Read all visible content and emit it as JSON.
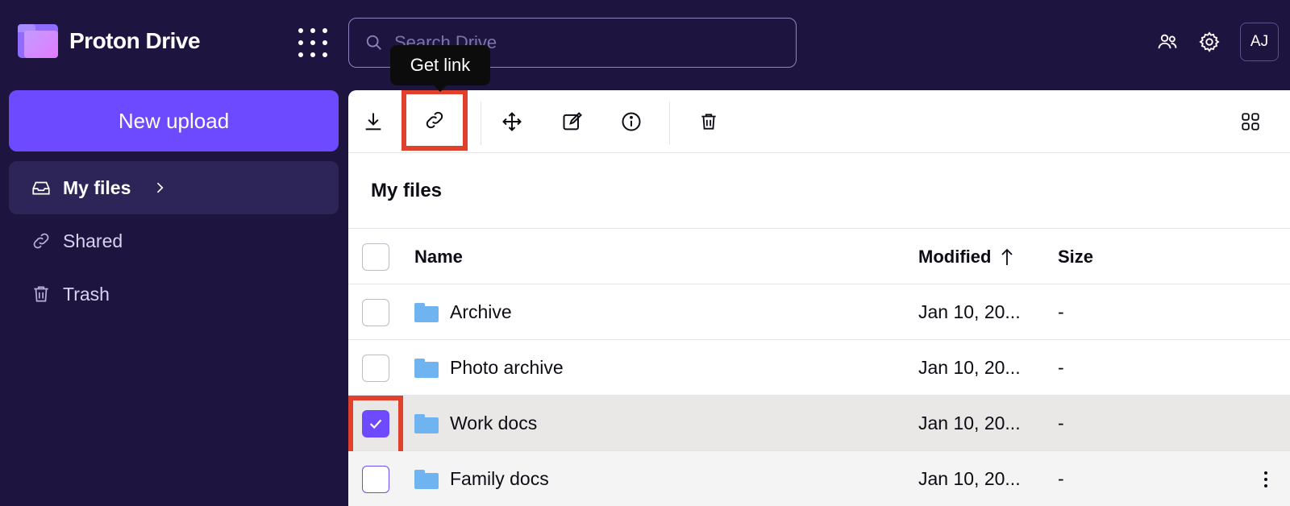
{
  "app": {
    "name": "Proton Drive"
  },
  "search": {
    "placeholder": "Search Drive"
  },
  "user": {
    "initials": "AJ"
  },
  "tooltip": {
    "text": "Get link"
  },
  "sidebar": {
    "new_upload_label": "New upload",
    "items": [
      {
        "label": "My files",
        "active": true
      },
      {
        "label": "Shared"
      },
      {
        "label": "Trash"
      }
    ]
  },
  "main": {
    "breadcrumb": "My files",
    "table": {
      "columns": {
        "name": "Name",
        "modified": "Modified",
        "size": "Size"
      },
      "rows": [
        {
          "name": "Archive",
          "modified": "Jan 10, 20...",
          "size": "-"
        },
        {
          "name": "Photo archive",
          "modified": "Jan 10, 20...",
          "size": "-"
        },
        {
          "name": "Work docs",
          "modified": "Jan 10, 20...",
          "size": "-",
          "selected": true
        },
        {
          "name": "Family docs",
          "modified": "Jan 10, 20...",
          "size": "-"
        }
      ]
    }
  },
  "colors": {
    "brand": "#6d4aff",
    "background": "#1d1540",
    "highlight": "#e0412c",
    "folder": "#6fb4f0"
  }
}
